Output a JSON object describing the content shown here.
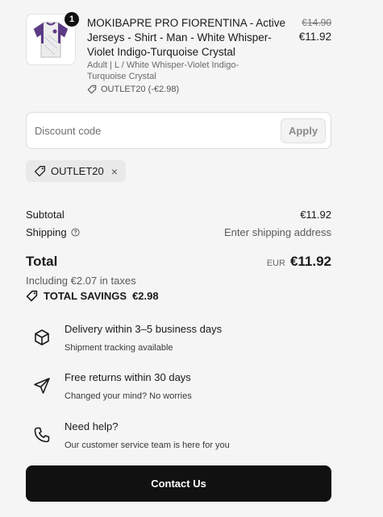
{
  "product": {
    "quantity": "1",
    "title": "MOKIBAPRE PRO FIORENTINA - Active Jerseys - Shirt - Man - White Whisper-Violet Indigo-Turquoise Crystal",
    "variant": "Adult | L / White Whisper-Violet Indigo-Turquoise Crystal",
    "discount": "OUTLET20 (-€2.98)",
    "price_original": "€14.90",
    "price_current": "€11.92"
  },
  "discount_form": {
    "placeholder": "Discount code",
    "apply_label": "Apply"
  },
  "applied_code": {
    "code": "OUTLET20",
    "remove_icon": "×"
  },
  "totals": {
    "subtotal_label": "Subtotal",
    "subtotal_value": "€11.92",
    "shipping_label": "Shipping",
    "shipping_value": "Enter shipping address",
    "total_label": "Total",
    "currency": "EUR",
    "total_value": "€11.92",
    "taxes_note": "Including €2.07 in taxes",
    "savings_label": "TOTAL SAVINGS",
    "savings_value": "€2.98"
  },
  "perks": [
    {
      "icon": "box-icon",
      "title": "Delivery within 3–5 business days",
      "subtitle": "Shipment tracking available"
    },
    {
      "icon": "paper-plane-icon",
      "title": "Free returns within 30 days",
      "subtitle": "Changed your mind? No worries"
    },
    {
      "icon": "phone-icon",
      "title": "Need help?",
      "subtitle": "Our customer service team is here for you"
    }
  ],
  "contact_button": "Contact Us",
  "colors": {
    "background": "#f5f5f5",
    "button": "#111111",
    "badge": "#111111",
    "jersey_violet": "#5b3a86"
  }
}
